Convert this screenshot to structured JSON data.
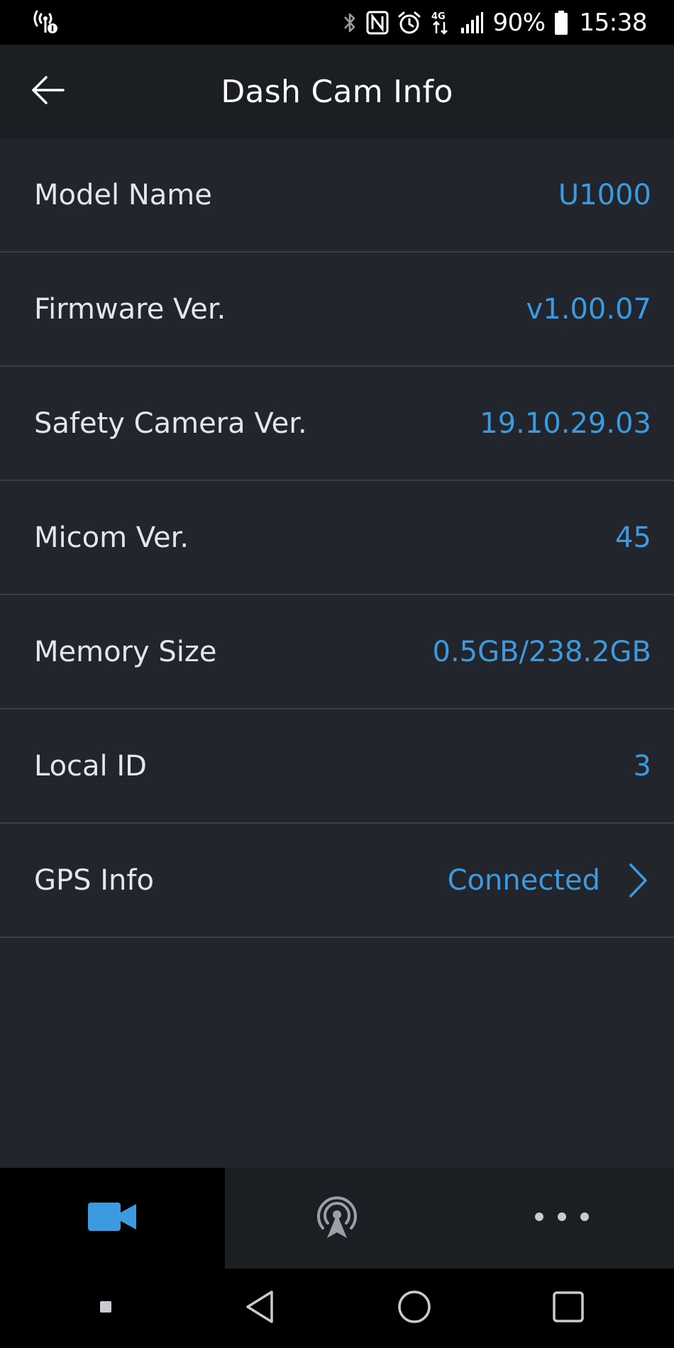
{
  "status_bar": {
    "battery_percent": "90%",
    "time": "15:38",
    "network_badge": "4G",
    "icons": [
      "wifi-hotspot-icon",
      "bluetooth-icon",
      "nfc-icon",
      "alarm-icon",
      "4g-data-icon",
      "signal-icon",
      "battery-icon"
    ]
  },
  "header": {
    "title": "Dash Cam Info",
    "back_icon": "arrow-left-icon"
  },
  "info": {
    "rows": [
      {
        "label": "Model Name",
        "value": "U1000"
      },
      {
        "label": "Firmware Ver.",
        "value": "v1.00.07"
      },
      {
        "label": "Safety Camera Ver.",
        "value": "19.10.29.03"
      },
      {
        "label": "Micom Ver.",
        "value": "45"
      },
      {
        "label": "Memory Size",
        "value": "0.5GB/238.2GB"
      },
      {
        "label": "Local ID",
        "value": "3"
      },
      {
        "label": "GPS Info",
        "value": "Connected"
      }
    ]
  },
  "bottom_nav": {
    "tabs": [
      {
        "icon": "video-camera-icon",
        "active": true
      },
      {
        "icon": "broadcast-icon",
        "active": false
      },
      {
        "icon": "more-dots-icon",
        "active": false
      }
    ]
  },
  "colors": {
    "accent": "#3b9ae0",
    "background": "#22252c",
    "bar": "#1b1e23",
    "divider": "#3a3e46"
  }
}
